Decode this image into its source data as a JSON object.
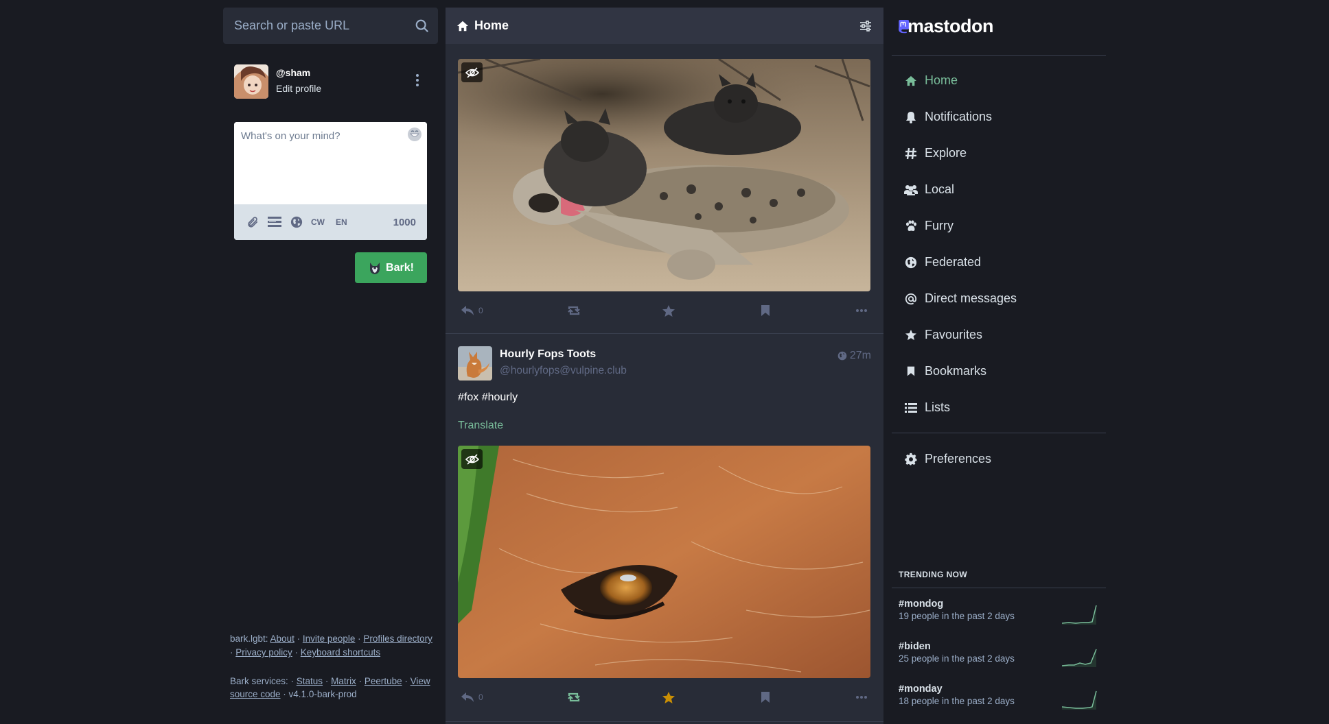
{
  "search": {
    "placeholder": "Search or paste URL"
  },
  "profile": {
    "handle": "@sham",
    "edit_label": "Edit profile"
  },
  "composer": {
    "placeholder": "What's on your mind?",
    "cw_label": "CW",
    "lang_label": "EN",
    "char_count": "1000",
    "submit_label": "Bark!"
  },
  "footer": {
    "site": "bark.lgbt",
    "about": "About",
    "invite": "Invite people",
    "profiles_directory": "Profiles directory",
    "privacy": "Privacy policy",
    "keyboard": "Keyboard shortcuts",
    "services_label": "Bark services",
    "status": "Status",
    "matrix": "Matrix",
    "peertube": "Peertube",
    "source": "View source code",
    "version": "v4.1.0-bark-prod"
  },
  "column": {
    "title": "Home"
  },
  "posts": [
    {
      "reply_count": "0"
    },
    {
      "display_name": "Hourly Fops Toots",
      "acct": "@hourlyfops@vulpine.club",
      "time": "27m",
      "text": "#fox #hourly",
      "translate_label": "Translate",
      "reply_count": "0"
    }
  ],
  "brand": {
    "name": "mastodon"
  },
  "nav": {
    "items": [
      {
        "label": "Home",
        "icon": "home-icon"
      },
      {
        "label": "Notifications",
        "icon": "bell-icon"
      },
      {
        "label": "Explore",
        "icon": "hashtag-icon"
      },
      {
        "label": "Local",
        "icon": "users-icon"
      },
      {
        "label": "Furry",
        "icon": "paw-icon"
      },
      {
        "label": "Federated",
        "icon": "globe-icon"
      },
      {
        "label": "Direct messages",
        "icon": "at-icon"
      },
      {
        "label": "Favourites",
        "icon": "star-icon"
      },
      {
        "label": "Bookmarks",
        "icon": "bookmark-icon"
      },
      {
        "label": "Lists",
        "icon": "list-icon"
      }
    ],
    "preferences": "Preferences"
  },
  "trending": {
    "heading": "TRENDING NOW",
    "items": [
      {
        "tag": "#mondog",
        "meta": "19 people in the past 2 days"
      },
      {
        "tag": "#biden",
        "meta": "25 people in the past 2 days"
      },
      {
        "tag": "#monday",
        "meta": "18 people in the past 2 days"
      }
    ]
  },
  "colors": {
    "background": "#191b22",
    "column": "#282c37",
    "accent_green": "#79bd9a",
    "button_green": "#3ba55d",
    "muted": "#606984",
    "favourite": "#ca8f04",
    "mastodon_purple": "#6364ff"
  }
}
